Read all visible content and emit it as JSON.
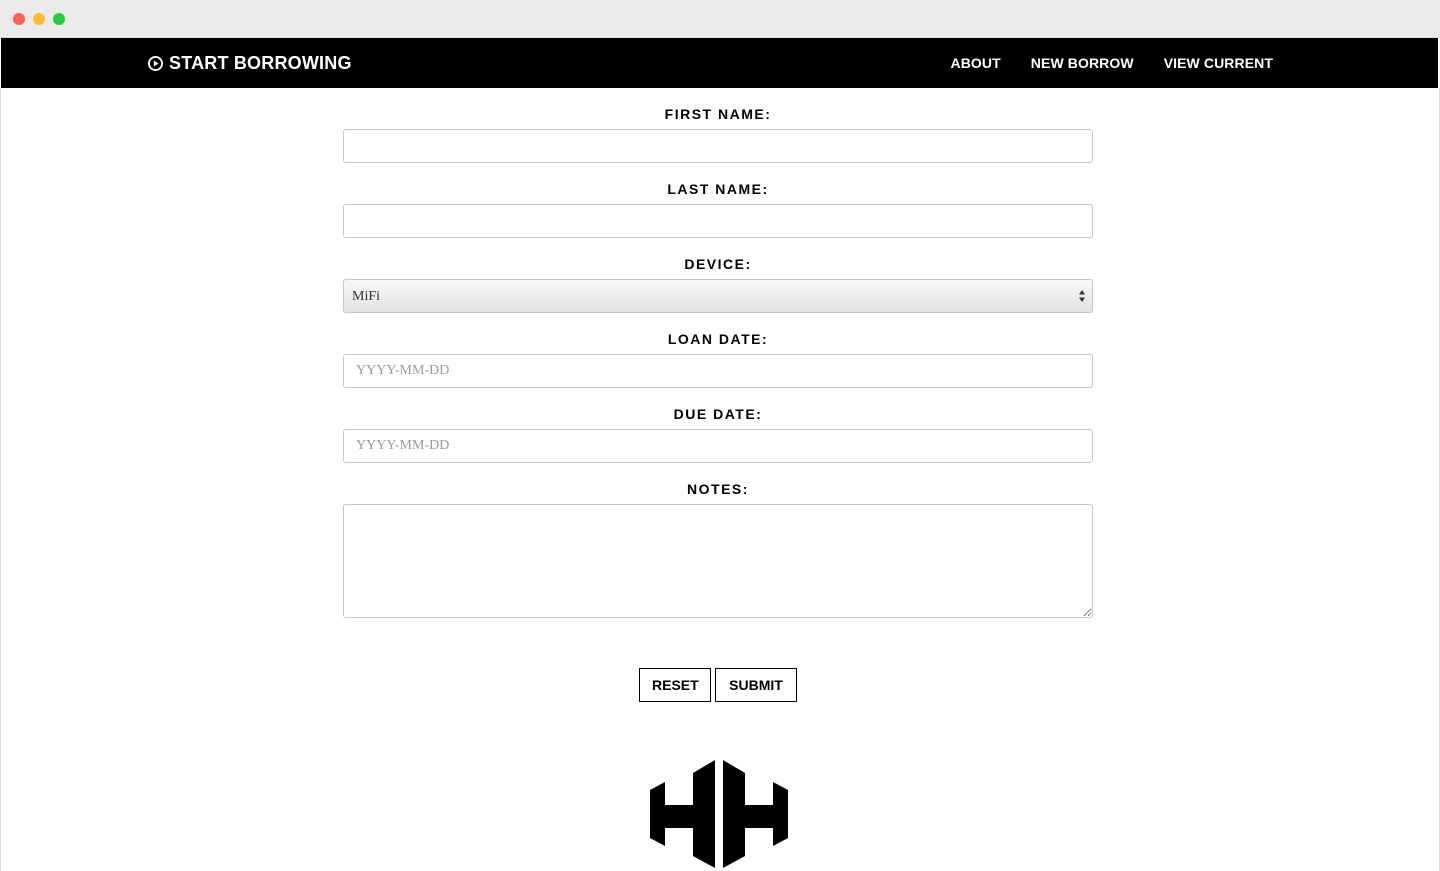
{
  "navbar": {
    "brand": "START BORROWING",
    "links": [
      "ABOUT",
      "NEW BORROW",
      "VIEW CURRENT"
    ]
  },
  "form": {
    "first_name_label": "FIRST NAME:",
    "first_name_value": "",
    "last_name_label": "LAST NAME:",
    "last_name_value": "",
    "device_label": "DEVICE:",
    "device_selected": "MiFi",
    "loan_date_label": "LOAN DATE:",
    "loan_date_placeholder": "YYYY-MM-DD",
    "due_date_label": "DUE DATE:",
    "due_date_placeholder": "YYYY-MM-DD",
    "notes_label": "NOTES:",
    "notes_value": ""
  },
  "buttons": {
    "reset_label": "RESET",
    "submit_label": "SUBMIT"
  },
  "icons": {
    "brand_icon": "play-circle-icon",
    "logo": "hh-logo"
  },
  "colors": {
    "navbar_bg": "#000000",
    "navbar_text": "#ffffff",
    "page_bg": "#ffffff"
  }
}
